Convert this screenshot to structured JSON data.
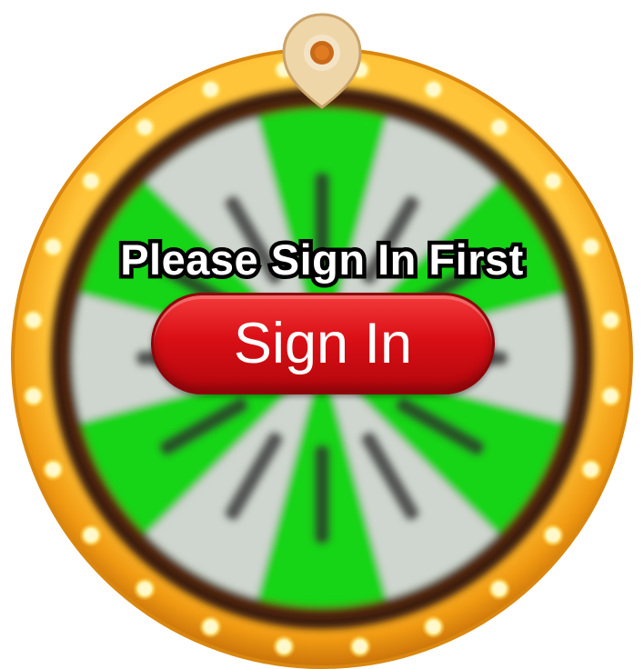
{
  "wheel": {
    "segment_count": 12,
    "segment_colors": [
      "#19d419",
      "#cfd6cf"
    ],
    "rim_color": "#f2a21e",
    "inner_ring_color": "#3a1b08",
    "bulb_color": "#fff3a0",
    "pointer_color": "#f0d6a8"
  },
  "overlay": {
    "title": "Please Sign In First",
    "button_label": "Sign In",
    "button_color": "#d90f15"
  }
}
